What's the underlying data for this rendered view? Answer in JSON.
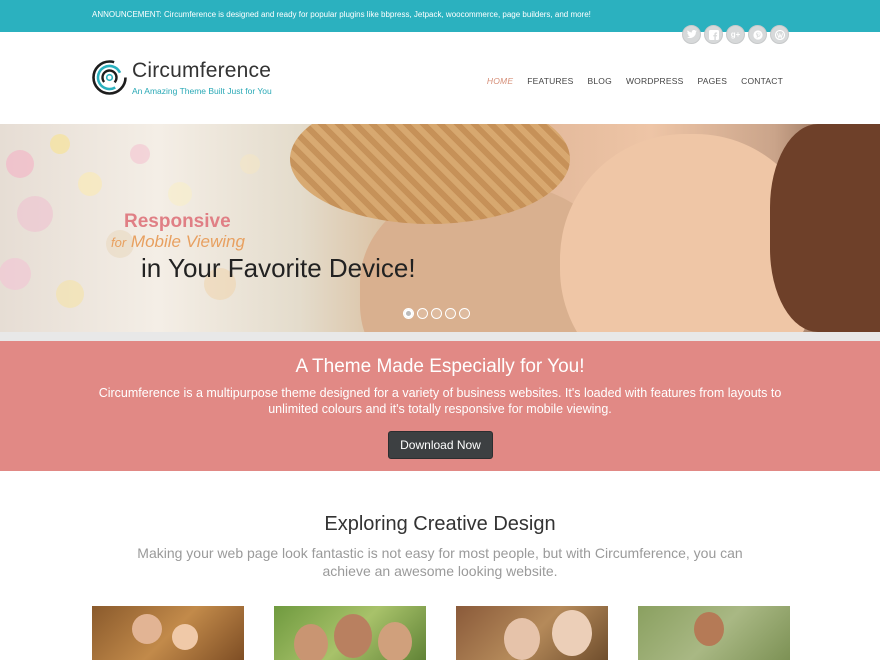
{
  "announcement": {
    "label": "ANNOUNCEMENT:",
    "text": " Circumference is designed and ready for popular plugins like bbpress, Jetpack, woocommerce, page builders, and more!"
  },
  "social": [
    {
      "name": "twitter-icon"
    },
    {
      "name": "facebook-icon"
    },
    {
      "name": "google-plus-icon",
      "glyph": "g+"
    },
    {
      "name": "pinterest-icon"
    },
    {
      "name": "wordpress-icon"
    }
  ],
  "brand": {
    "title": "Circumference",
    "tagline": "An Amazing Theme Built Just for You"
  },
  "nav": {
    "items": [
      "HOME",
      "FEATURES",
      "BLOG",
      "WORDPRESS",
      "PAGES",
      "CONTACT"
    ],
    "active": "HOME"
  },
  "hero": {
    "line1": "Responsive",
    "line2_small": "for",
    "line2": "Mobile Viewing",
    "line3": "in Your Favorite Device!",
    "slides_count": 5,
    "active_slide": 1
  },
  "promo": {
    "title": "A Theme Made Especially for You!",
    "text": "Circumference is a multipurpose theme designed for a variety of business websites. It's loaded with features from layouts to unlimited colours and it's totally responsive for mobile viewing.",
    "button": "Download Now"
  },
  "section": {
    "title": "Exploring Creative Design",
    "text": "Making your web page look fantastic is not easy for most people, but with Circumference, you can achieve an awesome looking website."
  },
  "colors": {
    "accent": "#2bb1bf",
    "promo": "#e18985",
    "nav_active": "#d68f78",
    "button": "#3d4042"
  }
}
